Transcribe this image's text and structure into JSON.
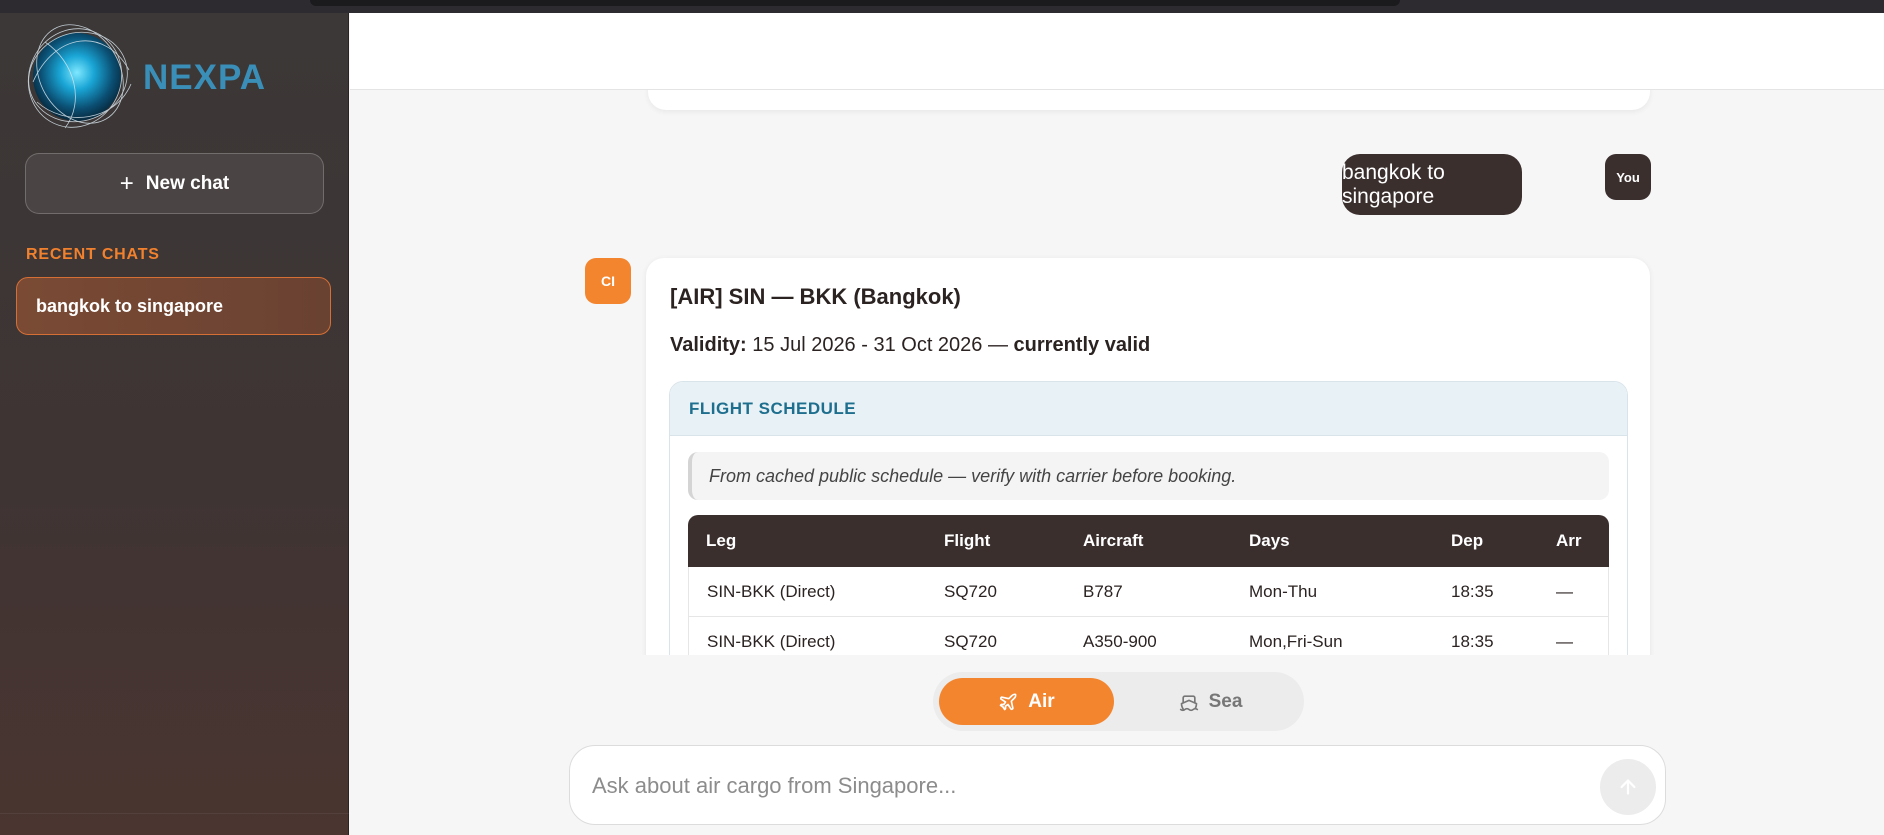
{
  "brand": {
    "name": "NEXPA"
  },
  "sidebar": {
    "new_chat_label": "New chat",
    "recent_title": "RECENT CHATS",
    "recent_items": [
      {
        "label": "bangkok to singapore"
      }
    ]
  },
  "conversation": {
    "user_message": "bangkok to singapore",
    "user_avatar": "You",
    "bot_avatar": "CI",
    "route_title": "[AIR] SIN — BKK (Bangkok)",
    "validity_label": "Validity:",
    "validity_dates": "15 Jul 2026 - 31 Oct 2026 —",
    "validity_status": "currently valid",
    "schedule": {
      "title": "FLIGHT SCHEDULE",
      "note": "From cached public schedule — verify with carrier before booking.",
      "columns": [
        "Leg",
        "Flight",
        "Aircraft",
        "Days",
        "Dep",
        "Arr"
      ],
      "rows": [
        [
          "SIN-BKK (Direct)",
          "SQ720",
          "B787",
          "Mon-Thu",
          "18:35",
          "—"
        ],
        [
          "SIN-BKK (Direct)",
          "SQ720",
          "A350-900",
          "Mon,Fri-Sun",
          "18:35",
          "—"
        ]
      ]
    }
  },
  "mode": {
    "air_label": "Air",
    "sea_label": "Sea",
    "selected": "Air",
    "accent": "#f4852f"
  },
  "composer": {
    "placeholder": "Ask about air cargo from Singapore..."
  },
  "colors": {
    "dark": "#3b2f2e",
    "brand_blue": "#3a8fb8",
    "schedule_title": "#1e6f8e"
  }
}
